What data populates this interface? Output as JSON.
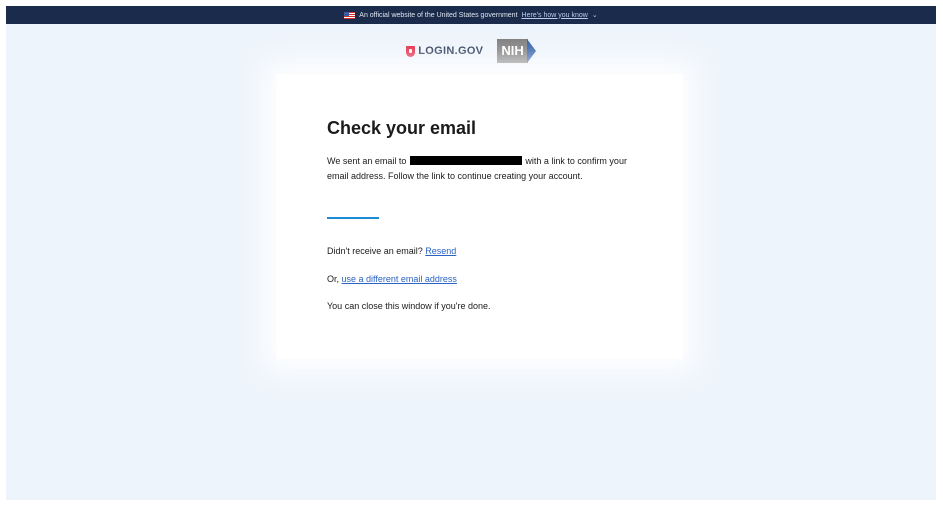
{
  "banner": {
    "text": "An official website of the United States government",
    "link": "Here's how you know",
    "chevron": "⌄"
  },
  "logos": {
    "login_gov": "LOGIN.GOV",
    "nih": "NIH"
  },
  "card": {
    "title": "Check your email",
    "message_before": "We sent an email to",
    "message_after": "with a link to confirm your email address. Follow the link to continue creating your account.",
    "no_email_text": "Didn't receive an email?",
    "resend_link": "Resend",
    "or_text": "Or,",
    "different_email_link": "use a different email address",
    "close_text": "You can close this window if you're done."
  },
  "colors": {
    "banner_bg": "#1b2b4b",
    "page_bg": "#eef4fb",
    "accent": "#1f8ad6",
    "link": "#2a63c4",
    "logo_red": "#e21c3d"
  }
}
